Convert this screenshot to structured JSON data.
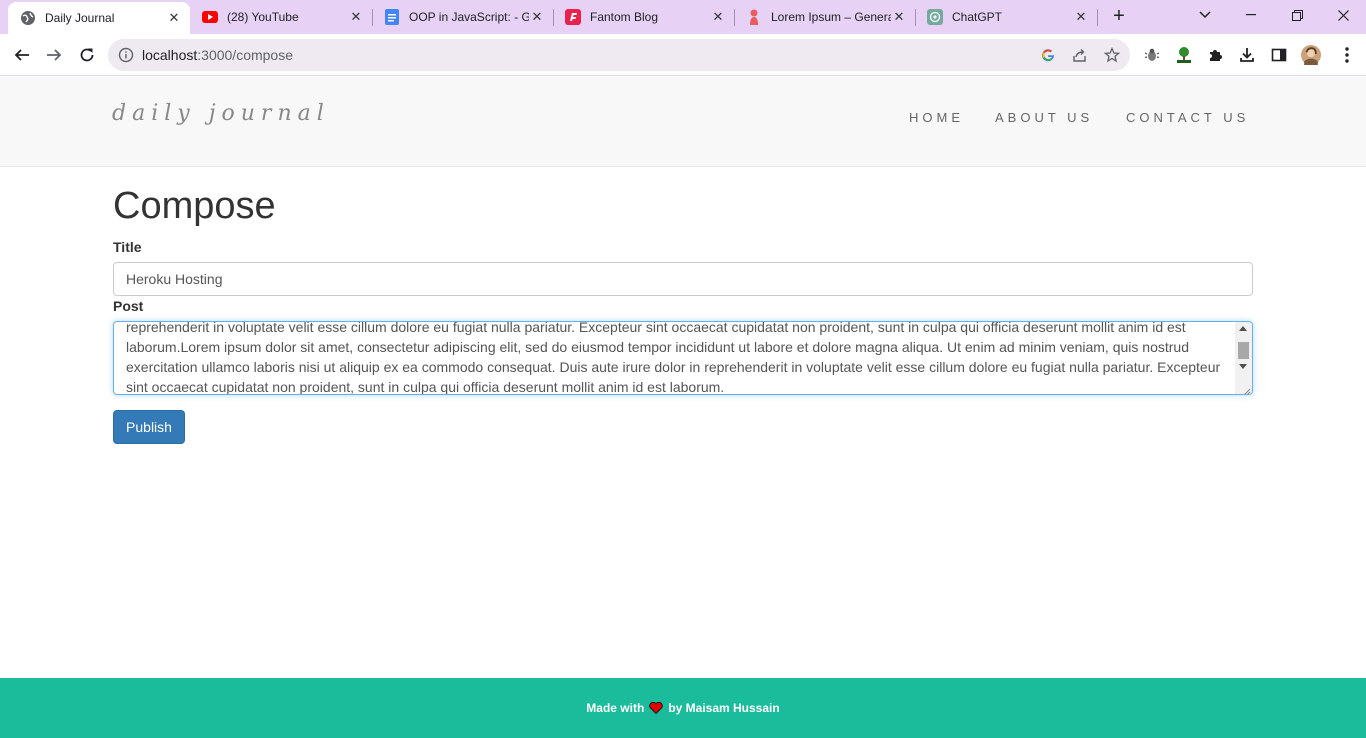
{
  "browser": {
    "tabs": [
      {
        "title": "Daily Journal",
        "icon": "globe-icon",
        "active": true
      },
      {
        "title": "(28) YouTube",
        "icon": "youtube-icon",
        "active": false
      },
      {
        "title": "OOP in JavaScript: - G",
        "icon": "google-docs-icon",
        "active": false
      },
      {
        "title": "Fantom Blog",
        "icon": "fantom-icon",
        "active": false
      },
      {
        "title": "Lorem Ipsum – Genera",
        "icon": "lorem-ipsum-icon",
        "active": false
      },
      {
        "title": "ChatGPT",
        "icon": "chatgpt-icon",
        "active": false
      }
    ],
    "url_host": "localhost",
    "url_rest": ":3000/compose"
  },
  "site": {
    "brand": "daily journal",
    "nav": [
      "HOME",
      "ABOUT US",
      "CONTACT US"
    ]
  },
  "compose": {
    "heading": "Compose",
    "title_label": "Title",
    "title_value": "Heroku Hosting",
    "post_label": "Post",
    "post_value": "reprehenderit in voluptate velit esse cillum dolore eu fugiat nulla pariatur. Excepteur sint occaecat cupidatat non proident, sunt in culpa qui officia deserunt mollit anim id est laborum.Lorem ipsum dolor sit amet, consectetur adipiscing elit, sed do eiusmod tempor incididunt ut labore et dolore magna aliqua. Ut enim ad minim veniam, quis nostrud exercitation ullamco laboris nisi ut aliquip ex ea commodo consequat. Duis aute irure dolor in reprehenderit in voluptate velit esse cillum dolore eu fugiat nulla pariatur. Excepteur sint occaecat cupidatat non proident, sunt in culpa qui officia deserunt mollit anim id est laborum.",
    "publish_label": "Publish"
  },
  "footer": {
    "made_with": "Made with",
    "by": "by Maisam Hussain"
  },
  "colors": {
    "tabstrip": "#e7d2f5",
    "footer": "#1abc9c",
    "publish": "#337ab7"
  }
}
